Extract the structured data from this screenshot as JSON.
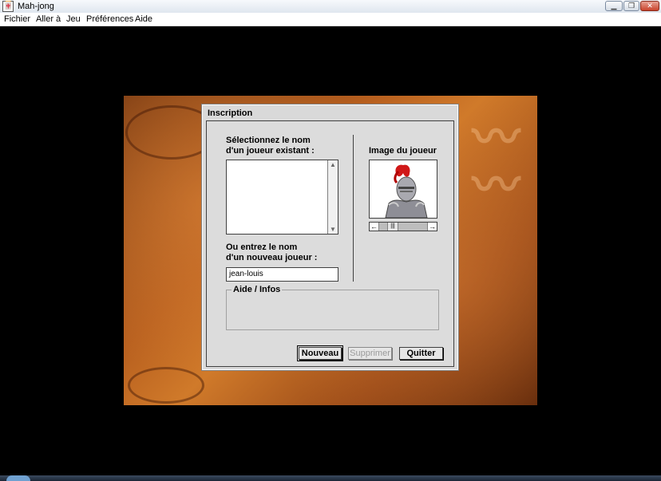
{
  "window": {
    "title": "Mah-jong",
    "icon": "mahjong-tile-icon",
    "controls": {
      "minimize_icon": "minimize-icon",
      "maximize_icon": "maximize-icon",
      "close_icon": "close-icon"
    }
  },
  "menubar": {
    "items": [
      "Fichier",
      "Aller à",
      "Jeu",
      "Préférences",
      "Aide"
    ]
  },
  "dialog": {
    "title": "Inscription",
    "existing_label": "Sélectionnez le nom\nd'un joueur existant :",
    "existing_list": [],
    "new_label": "Ou entrez le nom\nd'un nouveau joueur :",
    "new_player_value": "jean-louis",
    "image_label": "Image du joueur",
    "avatar": "knight-helmet-red-plume",
    "help_group_label": "Aide / Infos",
    "help_text": "",
    "buttons": {
      "new": "Nouveau",
      "delete": "Supprimer",
      "quit": "Quitter"
    },
    "delete_enabled": false
  },
  "colors": {
    "dialog_bg": "#d9d9d9",
    "background": "#000000",
    "game_art_accent": "#c0661f"
  }
}
